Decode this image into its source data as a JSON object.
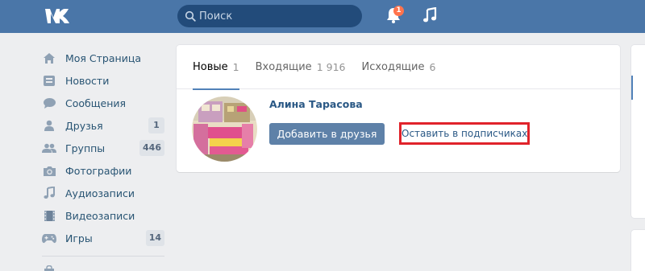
{
  "header": {
    "search_placeholder": "Поиск",
    "notifications_count": "1"
  },
  "menu": {
    "items": [
      {
        "label": "Моя Страница",
        "icon": "home-icon",
        "count": ""
      },
      {
        "label": "Новости",
        "icon": "news-icon",
        "count": ""
      },
      {
        "label": "Сообщения",
        "icon": "messages-icon",
        "count": ""
      },
      {
        "label": "Друзья",
        "icon": "friends-icon",
        "count": "1"
      },
      {
        "label": "Группы",
        "icon": "groups-icon",
        "count": "446"
      },
      {
        "label": "Фотографии",
        "icon": "camera-icon",
        "count": ""
      },
      {
        "label": "Аудиозаписи",
        "icon": "music-note-icon",
        "count": ""
      },
      {
        "label": "Видеозаписи",
        "icon": "film-icon",
        "count": ""
      },
      {
        "label": "Игры",
        "icon": "gamepad-icon",
        "count": "14"
      }
    ]
  },
  "tabs": [
    {
      "label": "Новые",
      "count": "1",
      "active": true
    },
    {
      "label": "Входящие",
      "count": "1 916",
      "active": false
    },
    {
      "label": "Исходящие",
      "count": "6",
      "active": false
    }
  ],
  "request": {
    "name": "Алина Тарасова",
    "add_button": "Добавить в друзья",
    "keep_button": "Оставить в подписчиках"
  },
  "colors": {
    "header_bg": "#4a76a8",
    "accent": "#5181b8",
    "highlight_border": "#e0232b",
    "badge": "#ff734c"
  }
}
